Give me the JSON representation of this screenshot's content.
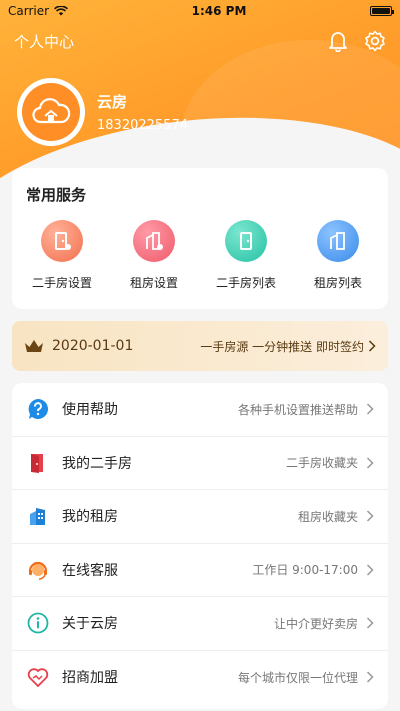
{
  "status_bar": {
    "carrier": "Carrier",
    "time": "1:46 PM"
  },
  "nav": {
    "title": "个人中心",
    "icons": [
      "bell-icon",
      "gear-icon"
    ]
  },
  "profile": {
    "name": "云房",
    "phone": "18320225574"
  },
  "services": {
    "title": "常用服务",
    "items": [
      {
        "label": "二手房设置",
        "icon": "door-settings-icon",
        "color": "#f2704e"
      },
      {
        "label": "租房设置",
        "icon": "building-settings-icon",
        "color": "#ef5a6b"
      },
      {
        "label": "二手房列表",
        "icon": "door-icon",
        "color": "#25c2a4"
      },
      {
        "label": "租房列表",
        "icon": "building-icon",
        "color": "#3a8bea"
      }
    ]
  },
  "vip": {
    "date": "2020-01-01",
    "promo": "一手房源 一分钟推送 即时签约"
  },
  "menu": {
    "items": [
      {
        "label": "使用帮助",
        "desc": "各种手机设置推送帮助",
        "icon": "help-icon"
      },
      {
        "label": "我的二手房",
        "desc": "二手房收藏夹",
        "icon": "door-icon"
      },
      {
        "label": "我的租房",
        "desc": "租房收藏夹",
        "icon": "building-icon"
      },
      {
        "label": "在线客服",
        "desc": "工作日 9:00-17:00",
        "icon": "headset-icon"
      },
      {
        "label": "关于云房",
        "desc": "让中介更好卖房",
        "icon": "info-icon"
      },
      {
        "label": "招商加盟",
        "desc": "每个城市仅限一位代理",
        "icon": "handshake-icon"
      }
    ]
  },
  "colors": {
    "accent": "#ff9d2a",
    "vip_bg": "#f8e4c2",
    "help_blue": "#1e8be6"
  }
}
